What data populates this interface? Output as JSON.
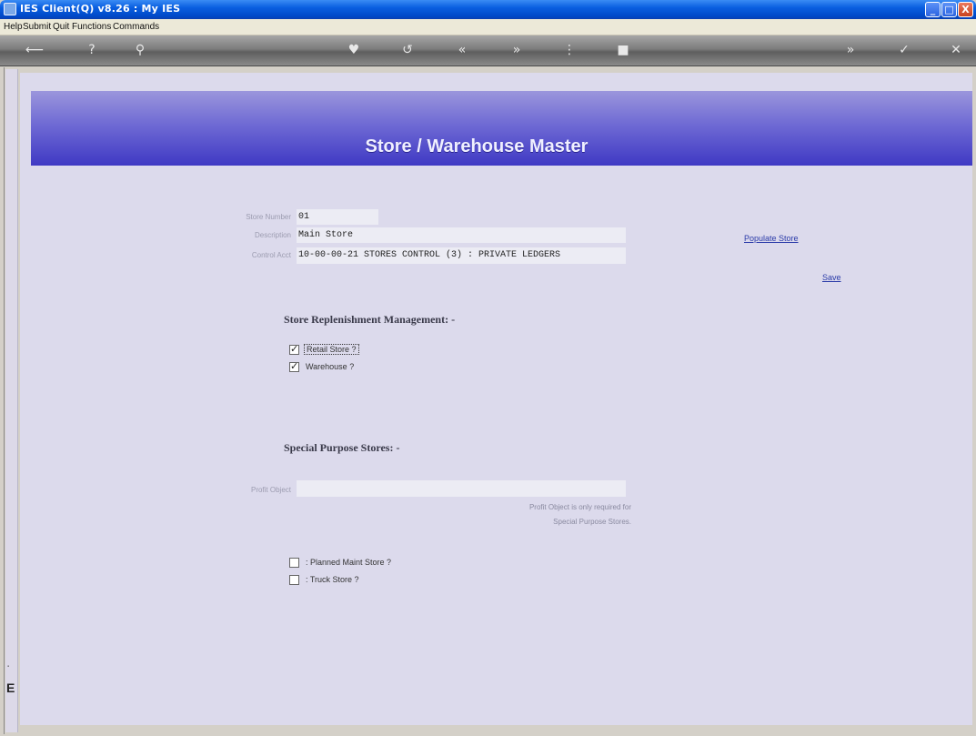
{
  "window": {
    "title": "IES Client(Q) v8.26 : My IES",
    "controls": {
      "minimize": "_",
      "maximize": "□",
      "close": "X"
    }
  },
  "menu": [
    "Help",
    "Submit",
    "Quit",
    "Functions",
    "Commands"
  ],
  "toolbar": {
    "buttons": [
      {
        "icon": "back-arrow-icon",
        "glyph": "⟵"
      },
      {
        "icon": "help-icon",
        "glyph": "?"
      },
      {
        "icon": "search-icon",
        "glyph": "⚲"
      },
      {
        "icon": "heart-icon",
        "glyph": "♥"
      },
      {
        "icon": "refresh-icon",
        "glyph": "↺"
      },
      {
        "icon": "previous-icon",
        "glyph": "«"
      },
      {
        "icon": "next-icon",
        "glyph": "»"
      },
      {
        "icon": "more-icon",
        "glyph": "⋮"
      },
      {
        "icon": "stop-icon",
        "glyph": "■"
      },
      {
        "icon": "forward-icon",
        "glyph": "»"
      },
      {
        "icon": "accept-icon",
        "glyph": "✓"
      },
      {
        "icon": "cancel-icon",
        "glyph": "✕"
      }
    ]
  },
  "page": {
    "title": "Store / Warehouse Master"
  },
  "form": {
    "store_number": {
      "label": "Store Number",
      "value": "01"
    },
    "description": {
      "label": "Description",
      "value": "Main Store"
    },
    "control_acct": {
      "label": "Control Acct",
      "value": "10-00-00-21 STORES CONTROL (3) : PRIVATE LEDGERS"
    },
    "profit_object": {
      "label": "Profit Object",
      "value": ""
    }
  },
  "links": {
    "populate": "Populate Store",
    "save": "Save"
  },
  "sections": {
    "replenishment": "Store Replenishment Management: -",
    "special": "Special Purpose Stores: -"
  },
  "checkboxes": {
    "retail": {
      "label": "Retail Store ?",
      "checked": true
    },
    "warehouse": {
      "label": "Warehouse ?",
      "checked": true
    },
    "planned_maint": {
      "label": ": Planned Maint Store ?",
      "checked": false
    },
    "truck": {
      "label": ": Truck Store ?",
      "checked": false
    }
  },
  "notes": {
    "profit_line1": "Profit Object is only required for",
    "profit_line2": "Special Purpose Stores."
  },
  "left_strip": {
    "glyph": "E"
  }
}
